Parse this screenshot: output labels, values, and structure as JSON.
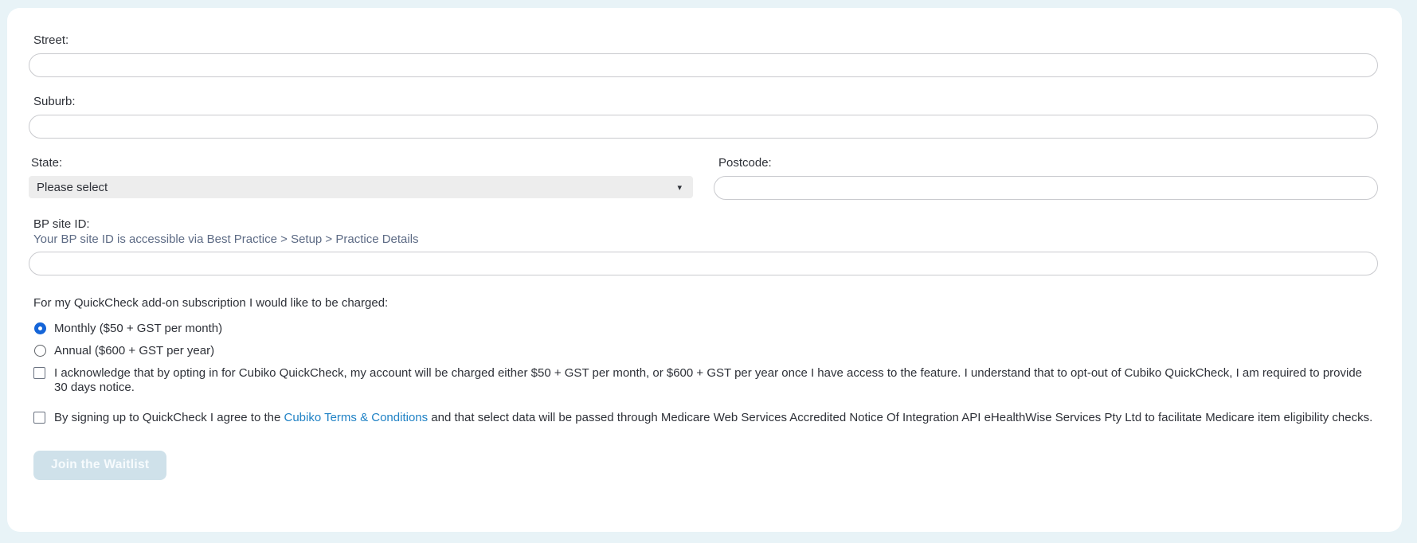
{
  "page": {
    "background_color": "#e8f3f7",
    "card_color": "#ffffff"
  },
  "form": {
    "fields": {
      "street": {
        "label": "Street:",
        "value": ""
      },
      "suburb": {
        "label": "Suburb:",
        "value": ""
      },
      "state": {
        "label": "State:",
        "selected_option": "Please select"
      },
      "postcode": {
        "label": "Postcode:",
        "value": ""
      },
      "bp_site_id": {
        "label": "BP site ID:",
        "helper": "Your BP site ID is accessible via Best Practice > Setup > Practice Details",
        "value": ""
      }
    },
    "billing": {
      "question": "For my QuickCheck add-on subscription I would like to be charged:",
      "options": [
        {
          "label": "Monthly ($50 + GST per month)",
          "selected": true
        },
        {
          "label": "Annual ($600 + GST per year)",
          "selected": false
        }
      ]
    },
    "agreements": [
      {
        "checked": false,
        "text": "I acknowledge that by opting in for Cubiko QuickCheck, my account will be charged either $50 + GST per month, or $600 + GST per year once I have access to the feature. I understand that to opt-out of Cubiko QuickCheck, I am required to provide 30 days notice."
      },
      {
        "checked": false,
        "text_before_link": "By signing up to QuickCheck I agree to the ",
        "link_text": "Cubiko Terms & Conditions",
        "text_after_link": " and that select data will be passed through Medicare Web Services Accredited Notice Of Integration API eHealthWise Services Pty Ltd to facilitate Medicare item eligibility checks."
      }
    ],
    "submit": {
      "label": "Join the Waitlist",
      "enabled": false
    }
  },
  "colors": {
    "accent_radio": "#1565d8",
    "link": "#2082c5",
    "helper_text": "#5d6b85",
    "disabled_button_bg": "#cfe1ea"
  },
  "icons": {
    "select_arrow": "▾"
  }
}
